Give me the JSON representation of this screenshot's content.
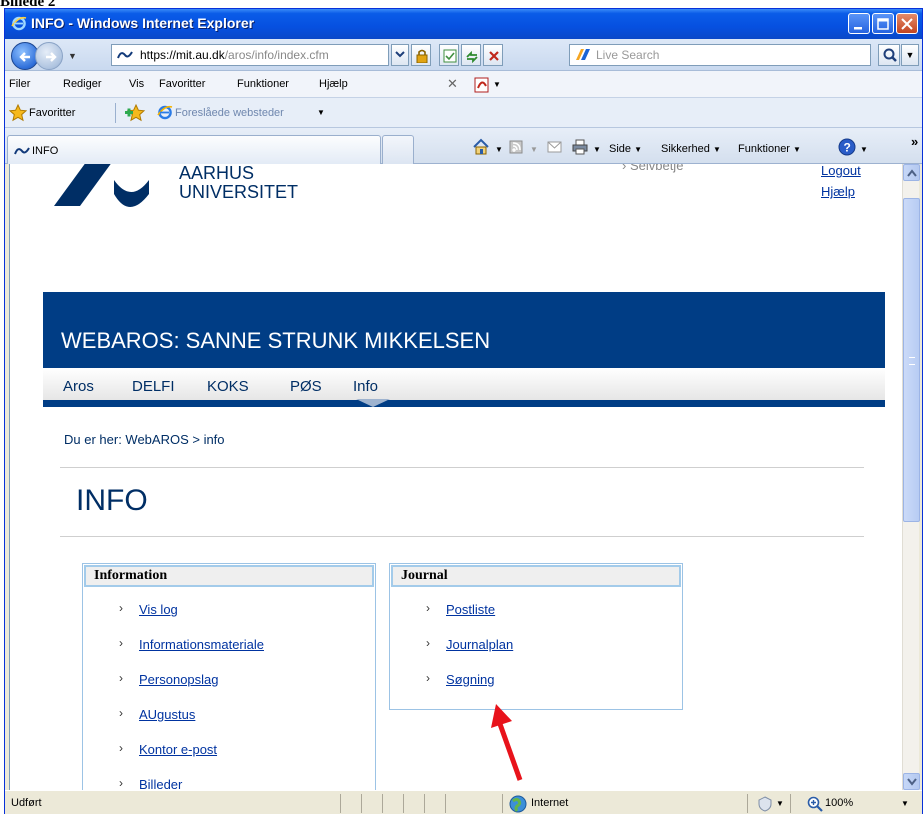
{
  "caption": "Billede 2",
  "window": {
    "title": "INFO - Windows Internet Explorer"
  },
  "address": {
    "domain": "https://mit.au.dk",
    "path": "/aros/info/index.cfm"
  },
  "search": {
    "placeholder": "Live Search"
  },
  "menu": [
    "Filer",
    "Rediger",
    "Vis",
    "Favoritter",
    "Funktioner",
    "Hjælp"
  ],
  "favorites": {
    "label": "Favoritter",
    "suggested": "Foreslåede websteder"
  },
  "tab": {
    "label": "INFO"
  },
  "commands": {
    "page": "Side",
    "security": "Sikkerhed",
    "tools": "Funktioner",
    "more": "»"
  },
  "site": {
    "university_line1": "AARHUS",
    "university_line2": "UNIVERSITET",
    "self_service": "› Selvbetje",
    "logout": "Logout",
    "help": "Hjælp",
    "banner_title": "WEBAROS: SANNE STRUNK MIKKELSEN",
    "nav": [
      "Aros",
      "DELFI",
      "KOKS",
      "PØS",
      "Info"
    ],
    "breadcrumb": "Du er her:  WebAROS  >  info",
    "page_title": "INFO"
  },
  "info_box": {
    "title": "Information",
    "items": [
      "Vis log",
      "Informationsmateriale",
      "Personopslag",
      "AUgustus",
      "Kontor e-post",
      "Billeder"
    ]
  },
  "journal_box": {
    "title": "Journal",
    "items": [
      "Postliste",
      "Journalplan",
      "Søgning"
    ]
  },
  "status": {
    "text": "Udført",
    "zone": "Internet",
    "zoom": "100%"
  },
  "colors": {
    "brand": "#003D85",
    "link": "#0033A0",
    "arrow": "#E8131B"
  }
}
